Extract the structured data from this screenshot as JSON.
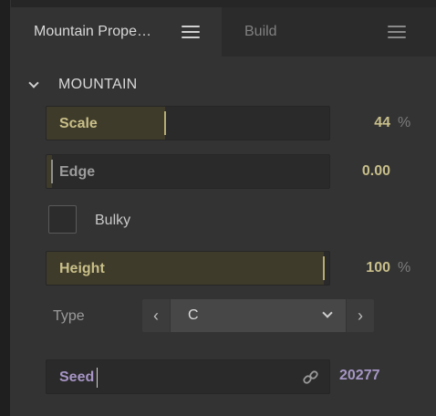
{
  "tabs": [
    {
      "label": "Mountain Prope…",
      "active": true
    },
    {
      "label": "Build",
      "active": false
    }
  ],
  "section": {
    "title": "MOUNTAIN",
    "expanded": true
  },
  "params": {
    "scale": {
      "label": "Scale",
      "value": "44",
      "unit": "%",
      "fraction": 0.44
    },
    "edge": {
      "label": "Edge",
      "value": "0.00",
      "fraction": 0.0
    },
    "bulky": {
      "label": "Bulky",
      "checked": false
    },
    "height": {
      "label": "Height",
      "value": "100",
      "unit": "%",
      "fraction": 1.0
    },
    "type": {
      "label": "Type",
      "value": "C",
      "prev_icon": "chevron-left-icon",
      "next_icon": "chevron-right-icon"
    },
    "seed": {
      "label": "Seed",
      "value": "20277",
      "icon": "link-icon"
    }
  },
  "colors": {
    "accent_gold": "#c8bf8a",
    "accent_purple": "#a596c4",
    "panel_bg": "#333333",
    "field_bg": "#2a2a2a"
  }
}
